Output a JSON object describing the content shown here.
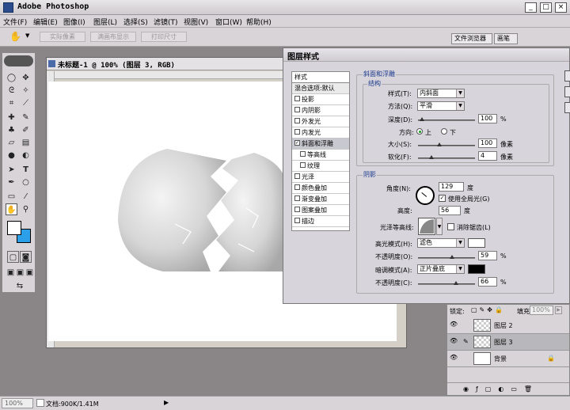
{
  "app": {
    "title": "Adobe Photoshop"
  },
  "window_controls": {
    "minimize": "_",
    "maximize": "□",
    "close": "×"
  },
  "menu": [
    "文件(F)",
    "编辑(E)",
    "图像(I)",
    "图层(L)",
    "选择(S)",
    "滤镜(T)",
    "视图(V)",
    "窗口(W)",
    "帮助(H)"
  ],
  "options_bar": {
    "btn1": "实际像素",
    "btn2": "满画布显示",
    "btn3": "打印尺寸"
  },
  "workspace_tabs": {
    "browser": "文件浏览器",
    "brush": "画笔"
  },
  "document": {
    "title": "未标题-1 @ 100% (图层 3, RGB)"
  },
  "dialog": {
    "title": "图层样式",
    "styles": [
      {
        "label": "样式",
        "checkbox": false,
        "checked": false,
        "header": true
      },
      {
        "label": "混合选项:默认",
        "checkbox": false,
        "checked": false
      },
      {
        "label": "投影",
        "checkbox": true,
        "checked": false
      },
      {
        "label": "内阴影",
        "checkbox": true,
        "checked": false
      },
      {
        "label": "外发光",
        "checkbox": true,
        "checked": false
      },
      {
        "label": "内发光",
        "checkbox": true,
        "checked": false
      },
      {
        "label": "斜面和浮雕",
        "checkbox": true,
        "checked": true,
        "selected": true
      },
      {
        "label": "等高线",
        "checkbox": true,
        "checked": false,
        "indent": true
      },
      {
        "label": "纹理",
        "checkbox": true,
        "checked": false,
        "indent": true
      },
      {
        "label": "光泽",
        "checkbox": true,
        "checked": false
      },
      {
        "label": "颜色叠加",
        "checkbox": true,
        "checked": false
      },
      {
        "label": "渐变叠加",
        "checkbox": true,
        "checked": false
      },
      {
        "label": "图案叠加",
        "checkbox": true,
        "checked": false
      },
      {
        "label": "描边",
        "checkbox": true,
        "checked": false
      }
    ],
    "bevel_group": "斜面和浮雕",
    "structure_group": "结构",
    "style_label": "样式(T):",
    "style_value": "内斜面",
    "technique_label": "方法(Q):",
    "technique_value": "平滑",
    "depth_label": "深度(D):",
    "depth_value": "100",
    "depth_unit": "%",
    "direction_label": "方向:",
    "direction_up": "上",
    "direction_down": "下",
    "size_label": "大小(S):",
    "size_value": "100",
    "size_unit": "像素",
    "soften_label": "软化(F):",
    "soften_value": "4",
    "soften_unit": "像素",
    "shading_group": "阴影",
    "angle_label": "角度(N):",
    "angle_value": "129",
    "angle_unit": "度",
    "global_light_label": "使用全局光(G)",
    "altitude_label": "高度:",
    "altitude_value": "56",
    "altitude_unit": "度",
    "gloss_label": "光泽等高线:",
    "antialias_label": "消除锯齿(L)",
    "highlight_label": "高光模式(H):",
    "highlight_value": "滤色",
    "opacity1_label": "不透明度(O):",
    "opacity1_value": "59",
    "opacity_unit": "%",
    "shadow_label": "暗调模式(A):",
    "shadow_value": "正片叠底",
    "opacity2_label": "不透明度(C):",
    "opacity2_value": "66",
    "highlight_color": "#ffffff",
    "shadow_color": "#000000"
  },
  "layers_panel": {
    "lock_label": "锁定:",
    "fill_label": "填充:",
    "fill_value": "100%",
    "layers": [
      "图层 2",
      "图层 3",
      "背景"
    ]
  },
  "status": {
    "zoom": "100%",
    "doc_info": "文档:900K/1.41M"
  }
}
